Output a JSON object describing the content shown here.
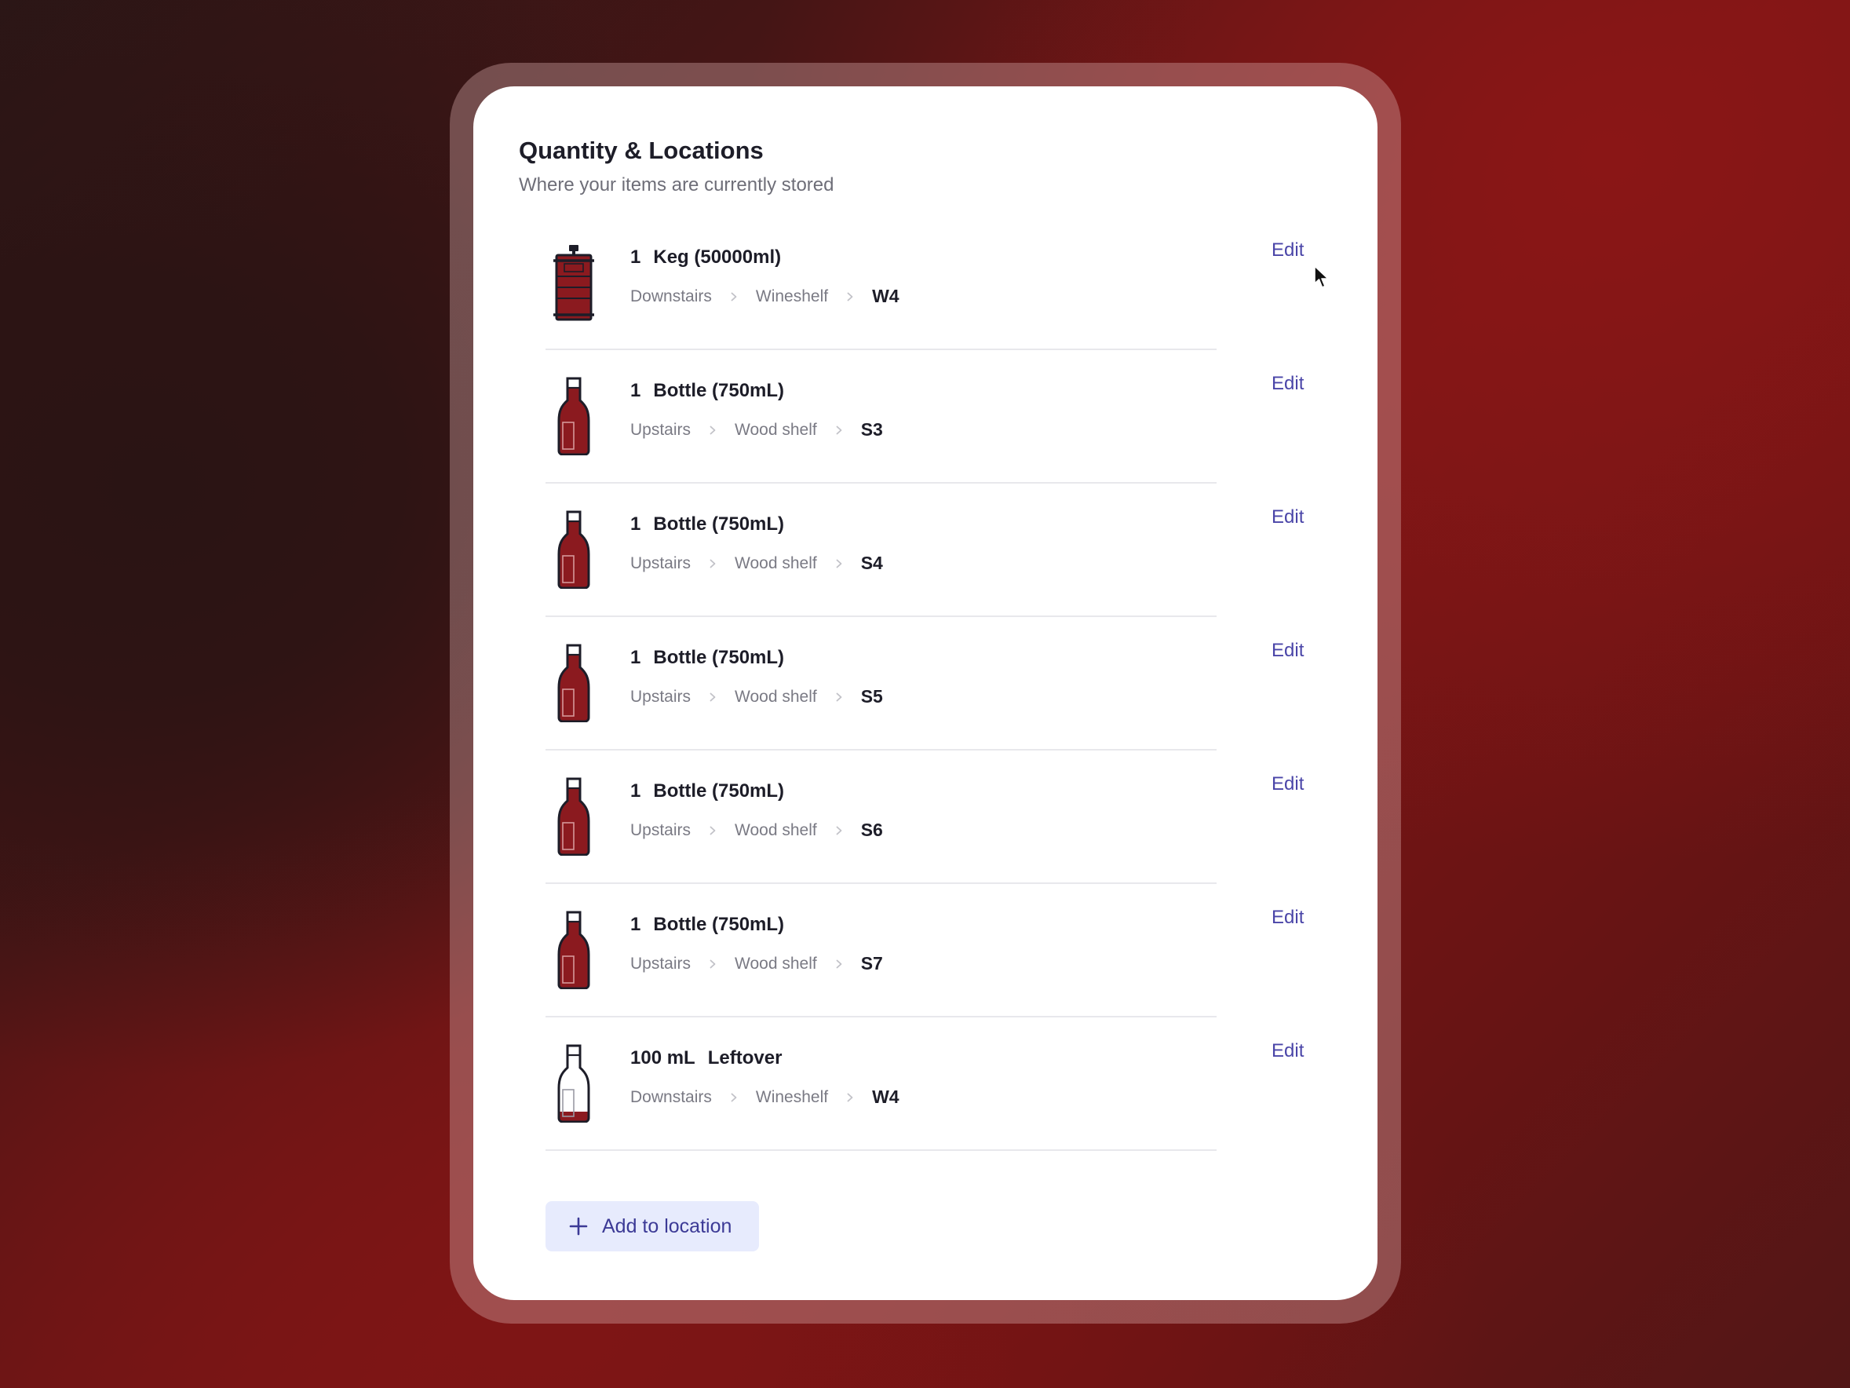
{
  "card": {
    "title": "Quantity & Locations",
    "subtitle": "Where your items are currently stored"
  },
  "items": [
    {
      "icon": "keg-icon",
      "quantity": "1",
      "container": "Keg (50000ml)",
      "location": [
        "Downstairs",
        "Wineshelf"
      ],
      "slot": "W4",
      "edit_label": "Edit"
    },
    {
      "icon": "wine-bottle-icon",
      "quantity": "1",
      "container": "Bottle (750mL)",
      "location": [
        "Upstairs",
        "Wood shelf"
      ],
      "slot": "S3",
      "edit_label": "Edit"
    },
    {
      "icon": "wine-bottle-icon",
      "quantity": "1",
      "container": "Bottle (750mL)",
      "location": [
        "Upstairs",
        "Wood shelf"
      ],
      "slot": "S4",
      "edit_label": "Edit"
    },
    {
      "icon": "wine-bottle-icon",
      "quantity": "1",
      "container": "Bottle (750mL)",
      "location": [
        "Upstairs",
        "Wood shelf"
      ],
      "slot": "S5",
      "edit_label": "Edit"
    },
    {
      "icon": "wine-bottle-icon",
      "quantity": "1",
      "container": "Bottle (750mL)",
      "location": [
        "Upstairs",
        "Wood shelf"
      ],
      "slot": "S6",
      "edit_label": "Edit"
    },
    {
      "icon": "wine-bottle-icon",
      "quantity": "1",
      "container": "Bottle (750mL)",
      "location": [
        "Upstairs",
        "Wood shelf"
      ],
      "slot": "S7",
      "edit_label": "Edit"
    },
    {
      "icon": "leftover-bottle-icon",
      "quantity": "100 mL",
      "container": "Leftover",
      "location": [
        "Downstairs",
        "Wineshelf"
      ],
      "slot": "W4",
      "edit_label": "Edit"
    }
  ],
  "add_button": {
    "label": "Add to location",
    "icon": "plus-icon"
  },
  "colors": {
    "wine": "#8b1a1f",
    "accent": "#4a45a8",
    "button_bg": "#e7ebfd"
  }
}
